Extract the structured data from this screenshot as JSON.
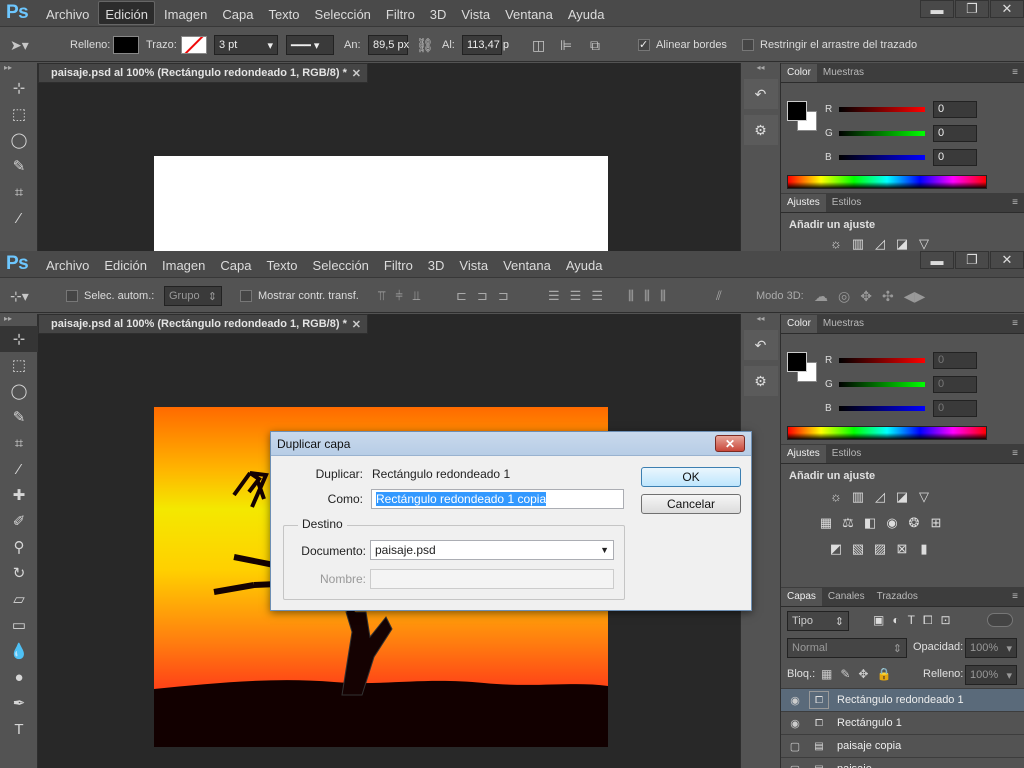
{
  "app": {
    "logo": "Ps"
  },
  "menu": [
    "Archivo",
    "Edición",
    "Imagen",
    "Capa",
    "Texto",
    "Selección",
    "Filtro",
    "3D",
    "Vista",
    "Ventana",
    "Ayuda"
  ],
  "win1": {
    "active_menu": "Edición",
    "options": {
      "relleno": "Relleno:",
      "trazo": "Trazo:",
      "stroke_size": "3 pt",
      "an_label": "An:",
      "an_value": "89,5 px",
      "al_label": "Al:",
      "al_value": "113,47 p",
      "alinear": "Alinear bordes",
      "restringir": "Restringir el arrastre del trazado"
    },
    "doc_tab": "paisaje.psd al 100% (Rectángulo redondeado 1, RGB/8) *",
    "color_panel": {
      "tabs": [
        "Color",
        "Muestras"
      ],
      "r": "0",
      "g": "0",
      "b": "0"
    },
    "adjust_panel": {
      "tabs": [
        "Ajustes",
        "Estilos"
      ],
      "title": "Añadir un ajuste"
    }
  },
  "win2": {
    "options": {
      "selec": "Selec. autom.:",
      "grupo": "Grupo",
      "mostrar": "Mostrar contr. transf.",
      "modo3d": "Modo 3D:"
    },
    "doc_tab": "paisaje.psd al 100% (Rectángulo redondeado 1, RGB/8) *",
    "color_panel": {
      "tabs": [
        "Color",
        "Muestras"
      ],
      "r": "0",
      "g": "0",
      "b": "0"
    },
    "adjust_panel": {
      "tabs": [
        "Ajustes",
        "Estilos"
      ],
      "title": "Añadir un ajuste"
    },
    "layers_panel": {
      "tabs": [
        "Capas",
        "Canales",
        "Trazados"
      ],
      "filter": "Tipo",
      "blend": "Normal",
      "opacity_label": "Opacidad:",
      "opacity": "100%",
      "lock_label": "Bloq.:",
      "fill_label": "Relleno:",
      "fill": "100%",
      "layers": [
        {
          "name": "Rectángulo redondeado 1",
          "visible": true,
          "selected": true
        },
        {
          "name": "Rectángulo 1",
          "visible": true,
          "selected": false
        },
        {
          "name": "paisaje copia",
          "visible": false,
          "selected": false
        },
        {
          "name": "paisaje",
          "visible": false,
          "selected": false
        }
      ]
    }
  },
  "dialog": {
    "title": "Duplicar capa",
    "duplicar_label": "Duplicar:",
    "duplicar_value": "Rectángulo redondeado 1",
    "como_label": "Como:",
    "como_value": "Rectángulo redondeado 1 copia",
    "destino": "Destino",
    "documento_label": "Documento:",
    "documento_value": "paisaje.psd",
    "nombre_label": "Nombre:",
    "ok": "OK",
    "cancel": "Cancelar"
  },
  "colors": {
    "ps_blue": "#6dc7ff",
    "panel": "#535353",
    "canvas_bg": "#282828"
  }
}
